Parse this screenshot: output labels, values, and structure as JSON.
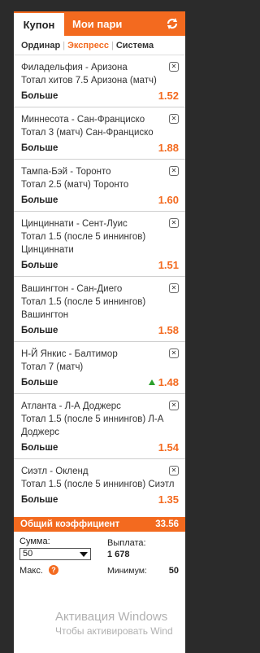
{
  "tabs": {
    "coupon": "Купон",
    "my_bets": "Мои пари"
  },
  "bet_types": [
    "Ординар",
    "Экспресс",
    "Система"
  ],
  "active_bet_type": "Экспресс",
  "bets": [
    {
      "match": "Филадельфия - Аризона",
      "market": "Тотал хитов 7.5 Аризона (матч)",
      "outcome": "Больше",
      "odd": "1.52"
    },
    {
      "match": "Миннесота - Сан-Франциско",
      "market": "Тотал 3 (матч) Сан-Франциско",
      "outcome": "Больше",
      "odd": "1.88"
    },
    {
      "match": "Тампа-Бэй - Торонто",
      "market": "Тотал 2.5 (матч) Торонто",
      "outcome": "Больше",
      "odd": "1.60"
    },
    {
      "match": "Цинциннати - Сент-Луис",
      "market": "Тотал 1.5 (после 5 иннингов) Цинциннати",
      "outcome": "Больше",
      "odd": "1.51"
    },
    {
      "match": "Вашингтон - Сан-Диего",
      "market": "Тотал 1.5 (после 5 иннингов) Вашингтон",
      "outcome": "Больше",
      "odd": "1.58"
    },
    {
      "match": "Н-Й Янкис - Балтимор",
      "market": "Тотал 7 (матч)",
      "outcome": "Больше",
      "odd": "1.48",
      "trend": "up"
    },
    {
      "match": "Атланта - Л-А Доджерс",
      "market": "Тотал 1.5 (после 5 иннингов) Л-А Доджерс",
      "outcome": "Больше",
      "odd": "1.54"
    },
    {
      "match": "Сиэтл - Окленд",
      "market": "Тотал 1.5 (после 5 иннингов) Сиэтл",
      "outcome": "Больше",
      "odd": "1.35"
    }
  ],
  "total": {
    "label": "Общий коэффициент",
    "value": "33.56"
  },
  "stake": {
    "label": "Сумма:",
    "value": "50"
  },
  "payout": {
    "label": "Выплата:",
    "value": "1 678"
  },
  "max": {
    "label": "Макс.",
    "info": "?"
  },
  "minimum": {
    "label": "Минимум:",
    "value": "50"
  },
  "watermark": {
    "line1": "Активация Windows",
    "line2": "Чтобы активировать Wind"
  },
  "colors": {
    "accent": "#f36a1f",
    "trend_up": "#2ca02c"
  }
}
